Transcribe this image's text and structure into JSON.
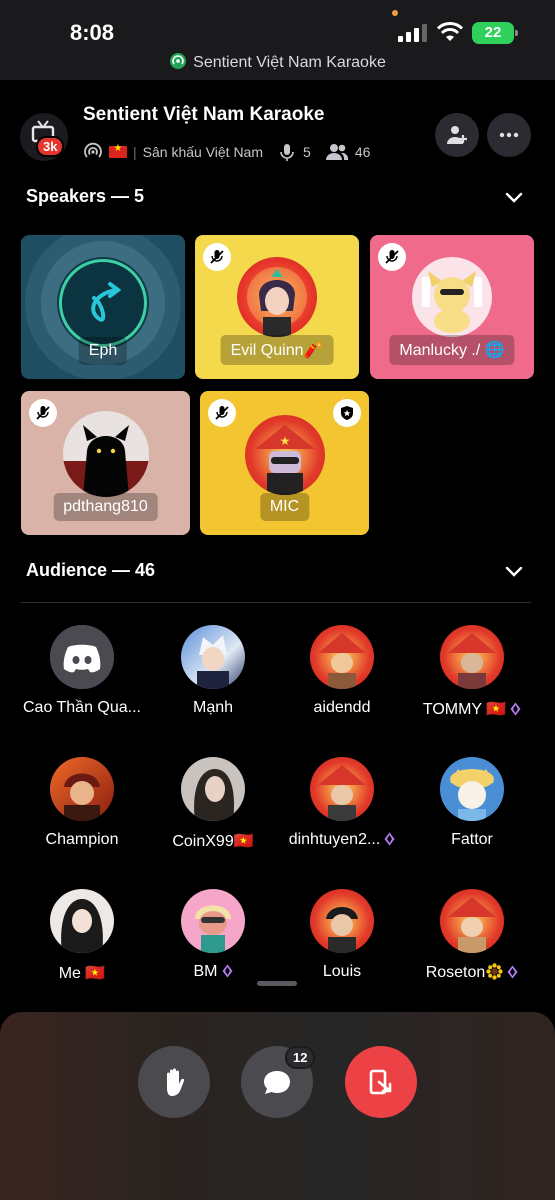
{
  "status_bar": {
    "time": "8:08",
    "battery": "22",
    "stage_label": "Sentient Việt Nam Karaoke"
  },
  "header": {
    "title": "Sentient Việt Nam Karaoke",
    "badge": "3k",
    "category": "Sân khấu Việt Nam",
    "speaker_count": "5",
    "listener_count": "46"
  },
  "speakers": {
    "title": "Speakers — 5",
    "items": [
      {
        "name": "Eph"
      },
      {
        "name": "Evil Quinn🧨"
      },
      {
        "name": "Manlucky ./ 🌐"
      },
      {
        "name": "pdthang810"
      },
      {
        "name": "MIC"
      }
    ]
  },
  "audience": {
    "title": "Audience — 46",
    "items": [
      {
        "name": "Cao Thần Qua..."
      },
      {
        "name": "Mạnh"
      },
      {
        "name": "aidendd"
      },
      {
        "name": "TOMMY 🇻🇳"
      },
      {
        "name": "Champion"
      },
      {
        "name": "CoinX99🇻🇳"
      },
      {
        "name": "dinhtuyen2..."
      },
      {
        "name": "Fattor"
      },
      {
        "name": "Me 🇻🇳"
      },
      {
        "name": "BM"
      },
      {
        "name": "Louis"
      },
      {
        "name": "Roseton"
      }
    ]
  },
  "controls": {
    "messages_count": "12"
  },
  "colors": {
    "accent_red": "#ed4245",
    "tile_teal": "#1f4e63",
    "tile_yellow": "#f5d94c",
    "tile_pink": "#f06b8b",
    "tile_beige": "#d9b3a8",
    "tile_gold": "#f2c531",
    "nitro_gem": "#b67cf5"
  }
}
